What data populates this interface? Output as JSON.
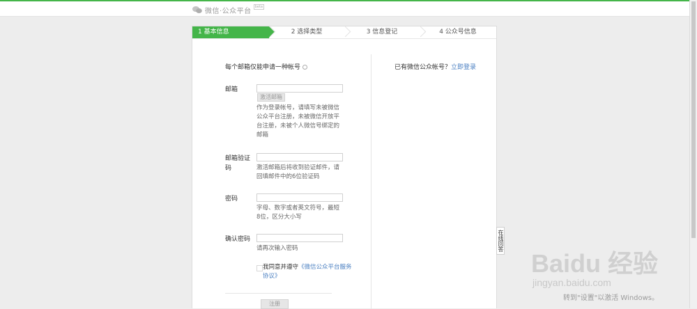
{
  "header": {
    "logo_text": "微信·公众平台",
    "badge": "beta"
  },
  "steps": [
    {
      "label": "1 基本信息",
      "active": true
    },
    {
      "label": "2 选择类型",
      "active": false
    },
    {
      "label": "3 信息登记",
      "active": false
    },
    {
      "label": "4 公众号信息",
      "active": false
    }
  ],
  "form": {
    "notice": "每个邮箱仅能申请一种帐号",
    "email": {
      "label": "邮箱",
      "value": "",
      "activate_button": "激活邮箱",
      "hint": "作为登录帐号，请填写未被微信公众平台注册，未被微信开放平台注册，未被个人微信号绑定的邮箱"
    },
    "email_code": {
      "label": "邮箱验证码",
      "value": "",
      "hint": "激活邮箱后将收到验证邮件，请回填邮件中的6位验证码"
    },
    "password": {
      "label": "密码",
      "value": "",
      "hint": "字母、数字或者英文符号，最短8位，区分大小写"
    },
    "confirm_password": {
      "label": "确认密码",
      "value": "",
      "hint": "请再次输入密码"
    },
    "agree_prefix": "我同意并遵守",
    "agree_link": "《微信公众平台服务协议》",
    "register_button": "注册"
  },
  "sidebar": {
    "question": "已有微信公众帐号？",
    "login_link": "立即登录"
  },
  "side_tab": {
    "label": "在线回答"
  },
  "watermark": {
    "main": "Baidu 经验",
    "sub": "jingyan.baidu.com"
  },
  "os_notice": "转到\"设置\"以激活 Windows。",
  "colors": {
    "accent": "#44b549",
    "link": "#4a7fc1"
  }
}
